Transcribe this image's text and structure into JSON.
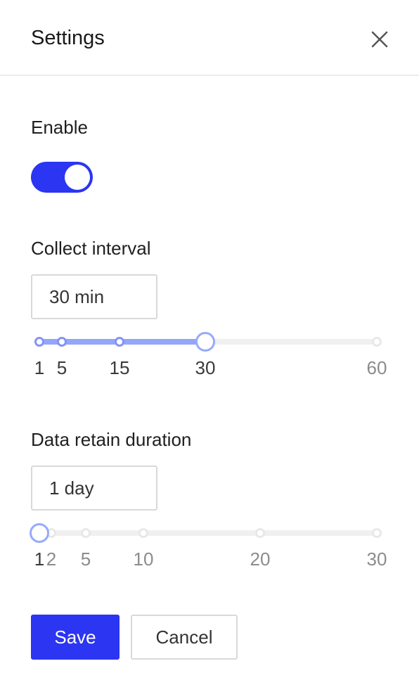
{
  "header": {
    "title": "Settings"
  },
  "enable": {
    "label": "Enable",
    "on": true
  },
  "collect": {
    "label": "Collect interval",
    "value_text": "30 min",
    "min": 1,
    "max": 60,
    "value": 30,
    "marks": [
      "1",
      "5",
      "15",
      "30",
      "60"
    ]
  },
  "retain": {
    "label": "Data retain duration",
    "value_text": "1 day",
    "min": 1,
    "max": 30,
    "value": 1,
    "marks": [
      "1",
      "2",
      "5",
      "10",
      "20",
      "30"
    ]
  },
  "actions": {
    "save_label": "Save",
    "cancel_label": "Cancel"
  },
  "colors": {
    "primary": "#2b35f2",
    "track": "#93a6fb",
    "rail": "#f0f0f0"
  }
}
